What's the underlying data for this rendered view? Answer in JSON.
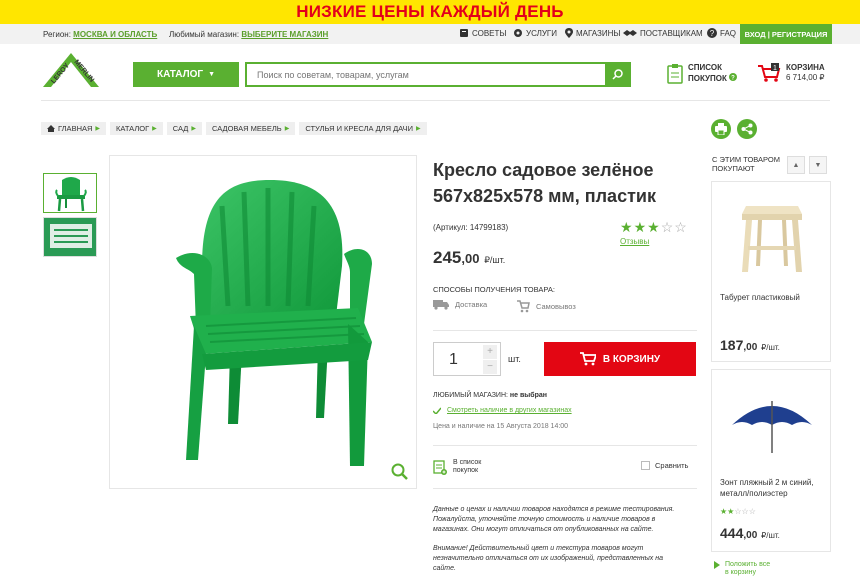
{
  "banner": {
    "text": "НИЗКИЕ ЦЕНЫ КАЖДЫЙ ДЕНЬ"
  },
  "topbar": {
    "region_label": "Регион:",
    "region_value": "МОСКВА И ОБЛАСТЬ",
    "store_label": "Любимый магазин:",
    "store_value": "ВЫБЕРИТЕ МАГАЗИН",
    "nav": [
      {
        "label": "СОВЕТЫ",
        "icon": "tips-icon"
      },
      {
        "label": "УСЛУГИ",
        "icon": "gear-icon"
      },
      {
        "label": "МАГАЗИНЫ",
        "icon": "location-pin-icon"
      },
      {
        "label": "ПОСТАВЩИКАМ",
        "icon": "handshake-icon"
      },
      {
        "label": "FAQ",
        "icon": "question-icon"
      }
    ],
    "login": "ВХОД | РЕГИСТРАЦИЯ"
  },
  "header": {
    "logo_text_1": "LEROY",
    "logo_text_2": "MERLIN",
    "catalog": "КАТАЛОГ",
    "search_placeholder": "Поиск по советам, товарам, услугам",
    "shoplist_line1": "СПИСОК",
    "shoplist_line2": "ПОКУПОК",
    "cart_label": "КОРЗИНА",
    "cart_total": "6 714,00 ₽",
    "cart_count": "1"
  },
  "breadcrumbs": [
    "ГЛАВНАЯ",
    "КАТАЛОГ",
    "САД",
    "САДОВАЯ МЕБЕЛЬ",
    "СТУЛЬЯ И КРЕСЛА ДЛЯ ДАЧИ"
  ],
  "product": {
    "title_line1": "Кресло садовое зелёное",
    "title_line2": "567x825x578 мм, пластик",
    "article": "(Артикул: 14799183)",
    "rating": 3,
    "reviews": "Отзывы",
    "price_int": "245",
    "price_dec": ",00",
    "price_unit": "₽/шт.",
    "ways_title": "СПОСОБЫ ПОЛУЧЕНИЯ ТОВАРА:",
    "way_delivery": "Доставка",
    "way_pickup": "Самовывоз",
    "quantity": "1",
    "qty_unit": "шт.",
    "buy": "В КОРЗИНУ",
    "fav_label": "ЛЮБИМЫЙ МАГАЗИН:",
    "fav_value": "не выбран",
    "availability": "Смотреть наличие в других магазинах",
    "price_info": "Цена и наличие на 15 Августа 2018 14:00",
    "add_list_1": "В список",
    "add_list_2": "покупок",
    "compare": "Сравнить",
    "note1": "Данные о ценах и наличии товаров находятся в режиме тестирования. Пожалуйста, уточняйте точную стоимость и наличие товаров в магазинах. Они могут отличаться от опубликованных на сайте.",
    "note2": "Внимание! Действительный цвет и текстура товаров могут незначительно отличаться от их изображений, представленных на сайте."
  },
  "sidebar": {
    "title": "С ЭТИМ ТОВАРОМ ПОКУПАЮТ",
    "items": [
      {
        "name": "Табурет пластиковый",
        "price_int": "187",
        "price_dec": ",00",
        "unit": "₽/шт."
      },
      {
        "name": "Зонт пляжный 2 м синий, металл/полиэстер",
        "price_int": "444",
        "price_dec": ",00",
        "unit": "₽/шт.",
        "rating": 2
      }
    ],
    "add_cart_1": "Положить все",
    "add_cart_2": "в корзину"
  },
  "colors": {
    "green": "#5ab031",
    "red": "#e30613",
    "yellow": "#ffe600",
    "chair": "#1fa84a"
  }
}
